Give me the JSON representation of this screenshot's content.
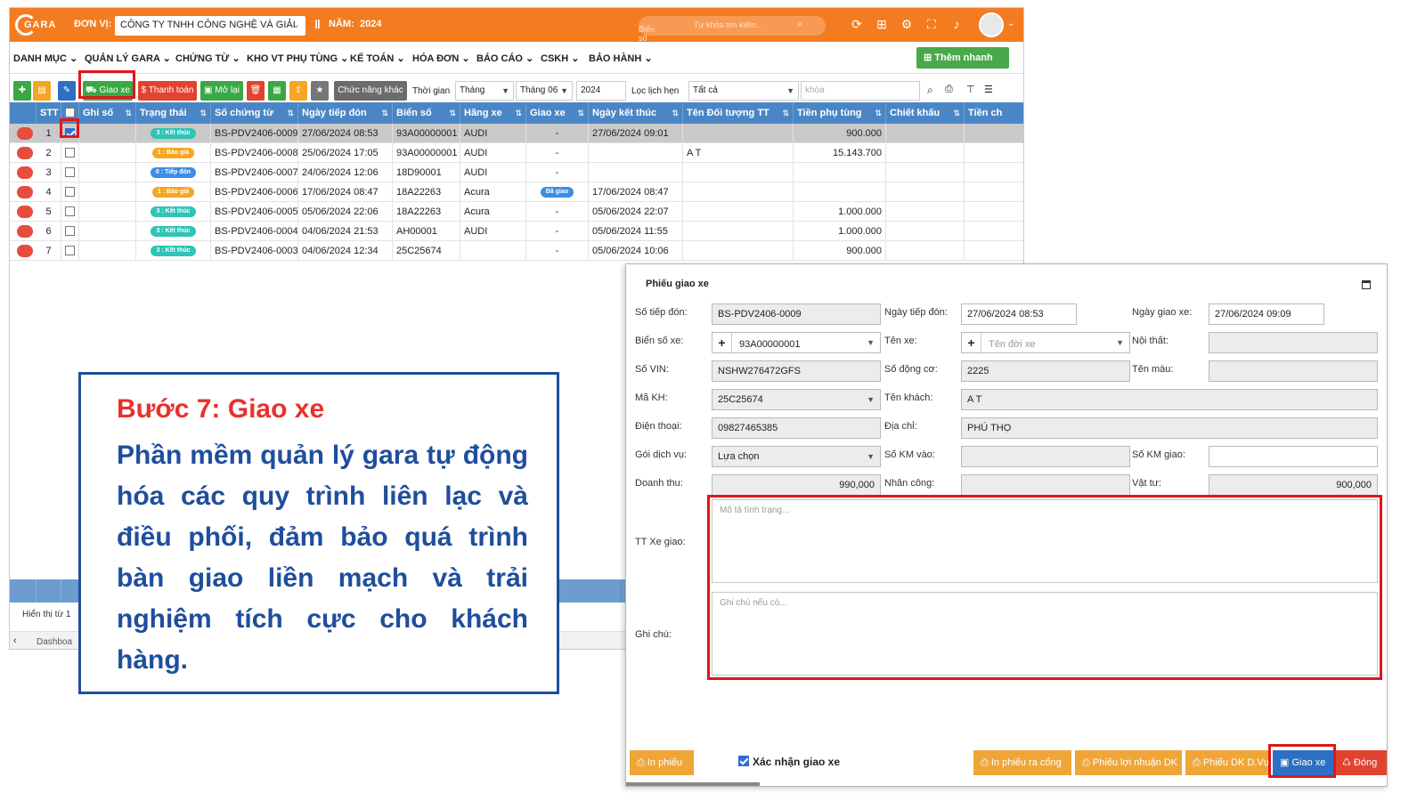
{
  "colors": {
    "brand_orange": "#f47c20",
    "grid_header": "#4a86c5",
    "callout_border": "#1f4e9c",
    "callout_heading": "#e8312a",
    "highlight_red": "#e0161b"
  },
  "app": {
    "logo_text": "GARA",
    "unit_label": "ĐƠN VỊ:",
    "unit_value": "CÔNG TY TNHH CÔNG NGHỆ VÀ GIẢI",
    "year_label": "NĂM:",
    "year_value": "2024",
    "plate_filter": "Biển số",
    "search_placeholder": "Từ khóa tìm kiếm..."
  },
  "menu": {
    "items": [
      "DANH MỤC",
      "QUẢN LÝ GARA",
      "CHỨNG TỪ",
      "KHO VT PHỤ TÙNG",
      "KẾ TOÁN",
      "HÓA ĐƠN",
      "BÁO CÁO",
      "CSKH",
      "BẢO HÀNH"
    ],
    "quick_add": "Thêm nhanh"
  },
  "toolbar": {
    "giao_xe": "Giao xe",
    "thanh_toan": "Thanh toán",
    "mo_lai": "Mở lại",
    "other_functions": "Chức năng khác",
    "time_label": "Thời gian",
    "time_value": "Tháng",
    "month_value": "Tháng 06",
    "year_value": "2024",
    "schedule_label": "Lọc lịch hẹn",
    "schedule_value": "Tất cả",
    "keyword_placeholder": "khóa"
  },
  "grid": {
    "headers": [
      "STT",
      "Ghi số",
      "Trạng thái",
      "Số chứng từ",
      "Ngày tiếp đón",
      "Biển số",
      "Hãng xe",
      "Giao xe",
      "Ngày kết thúc",
      "Tên Đối tượng TT",
      "Tiền phụ tùng",
      "Chiết khấu",
      "Tiền ch"
    ],
    "rows": [
      {
        "stt": "1",
        "checked": true,
        "status": "3 : Kết thúc",
        "status_color": "#2ec4b6",
        "doc": "BS-PDV2406-0009",
        "date": "27/06/2024 08:53",
        "plate": "93A00000001",
        "brand": "AUDI",
        "delivery": "-",
        "end": "27/06/2024 09:01",
        "party": "",
        "parts": "900.000"
      },
      {
        "stt": "2",
        "checked": false,
        "status": "1 : Báo giá",
        "status_color": "#f5a623",
        "doc": "BS-PDV2406-0008",
        "date": "25/06/2024 17:05",
        "plate": "93A00000001",
        "brand": "AUDI",
        "delivery": "-",
        "end": "",
        "party": "A T",
        "parts": "15.143.700"
      },
      {
        "stt": "3",
        "checked": false,
        "status": "0 : Tiếp đón",
        "status_color": "#3a8ee6",
        "doc": "BS-PDV2406-0007",
        "date": "24/06/2024 12:06",
        "plate": "18D90001",
        "brand": "AUDI",
        "delivery": "-",
        "end": "",
        "party": "",
        "parts": ""
      },
      {
        "stt": "4",
        "checked": false,
        "status": "1 : Báo giá",
        "status_color": "#f5a623",
        "doc": "BS-PDV2406-0006",
        "date": "17/06/2024 08:47",
        "plate": "18A22263",
        "brand": "Acura",
        "delivery": "Đã giao",
        "end": "17/06/2024 08:47",
        "party": "",
        "parts": ""
      },
      {
        "stt": "5",
        "checked": false,
        "status": "3 : Kết thúc",
        "status_color": "#2ec4b6",
        "doc": "BS-PDV2406-0005",
        "date": "05/06/2024 22:06",
        "plate": "18A22263",
        "brand": "Acura",
        "delivery": "-",
        "end": "05/06/2024 22:07",
        "party": "",
        "parts": "1.000.000"
      },
      {
        "stt": "6",
        "checked": false,
        "status": "3 : Kết thúc",
        "status_color": "#2ec4b6",
        "doc": "BS-PDV2406-0004",
        "date": "04/06/2024 21:53",
        "plate": "AH00001",
        "brand": "AUDI",
        "delivery": "-",
        "end": "05/06/2024 11:55",
        "party": "",
        "parts": "1.000.000"
      },
      {
        "stt": "7",
        "checked": false,
        "status": "3 : Kết thúc",
        "status_color": "#2ec4b6",
        "doc": "BS-PDV2406-0003",
        "date": "04/06/2024 12:34",
        "plate": "25C25674",
        "brand": "",
        "delivery": "-",
        "end": "05/06/2024 10:06",
        "party": "",
        "parts": "900.000"
      }
    ],
    "pager_text": "Hiển thị từ 1",
    "status_bar": "Dashboa"
  },
  "callout": {
    "step": "Bước 7: Giao xe",
    "body": "Phần mềm quản lý gara tự động hóa các quy trình liên lạc và điều phối, đảm bảo quá trình bàn giao liền mạch và trải nghiệm tích cực cho khách hàng."
  },
  "dialog": {
    "title": "Phiếu giao xe",
    "labels": {
      "so_tiep_don": "Số tiếp đón:",
      "ngay_tiep_don": "Ngày tiếp đón:",
      "ngay_giao_xe": "Ngày giao xe:",
      "bien_so_xe": "Biển số xe:",
      "ten_xe": "Tên xe:",
      "noi_that": "Nội thất:",
      "so_vin": "Số VIN:",
      "so_dong_co": "Số động cơ:",
      "ten_mau": "Tên màu:",
      "ma_kh": "Mã KH:",
      "ten_khach": "Tên khách:",
      "dien_thoai": "Điện thoại:",
      "dia_chi": "Địa chỉ:",
      "goi_dich_vu": "Gói dịch vụ:",
      "so_km_vao": "Số KM vào:",
      "so_km_giao": "Số KM giao:",
      "doanh_thu": "Doanh thu:",
      "nhan_cong": "Nhân công:",
      "vat_tu": "Vật tư:",
      "tt_xe_giao": "TT Xe giao:",
      "ghi_chu": "Ghi chú:"
    },
    "values": {
      "so_tiep_don": "BS-PDV2406-0009",
      "ngay_tiep_don": "27/06/2024 08:53",
      "ngay_giao_xe": "27/06/2024 09:09",
      "bien_so_xe": "93A00000001",
      "ten_xe_placeholder": "Tên đời xe",
      "so_vin": "NSHW276472GFS",
      "so_dong_co": "2225",
      "ma_kh": "25C25674",
      "ten_khach": "A T",
      "dien_thoai": "09827465385",
      "dia_chi": "PHÚ THỌ",
      "goi_dich_vu": "Lựa chọn",
      "doanh_thu": "990,000",
      "vat_tu": "900,000"
    },
    "placeholders": {
      "tt_xe_giao": "Mô tả tình trạng...",
      "ghi_chu": "Ghi chú nếu có..."
    },
    "footer": {
      "in_phieu": "In phiếu",
      "confirm": "Xác nhận giao xe",
      "in_phieu_ra_cong": "In phiếu ra cổng",
      "phieu_loi_nhuan": "Phiếu lợi nhuận DK",
      "phieu_dk_dvu": "Phiếu DK D.Vụ",
      "giao_xe": "Giao xe",
      "dong": "Đóng"
    }
  }
}
